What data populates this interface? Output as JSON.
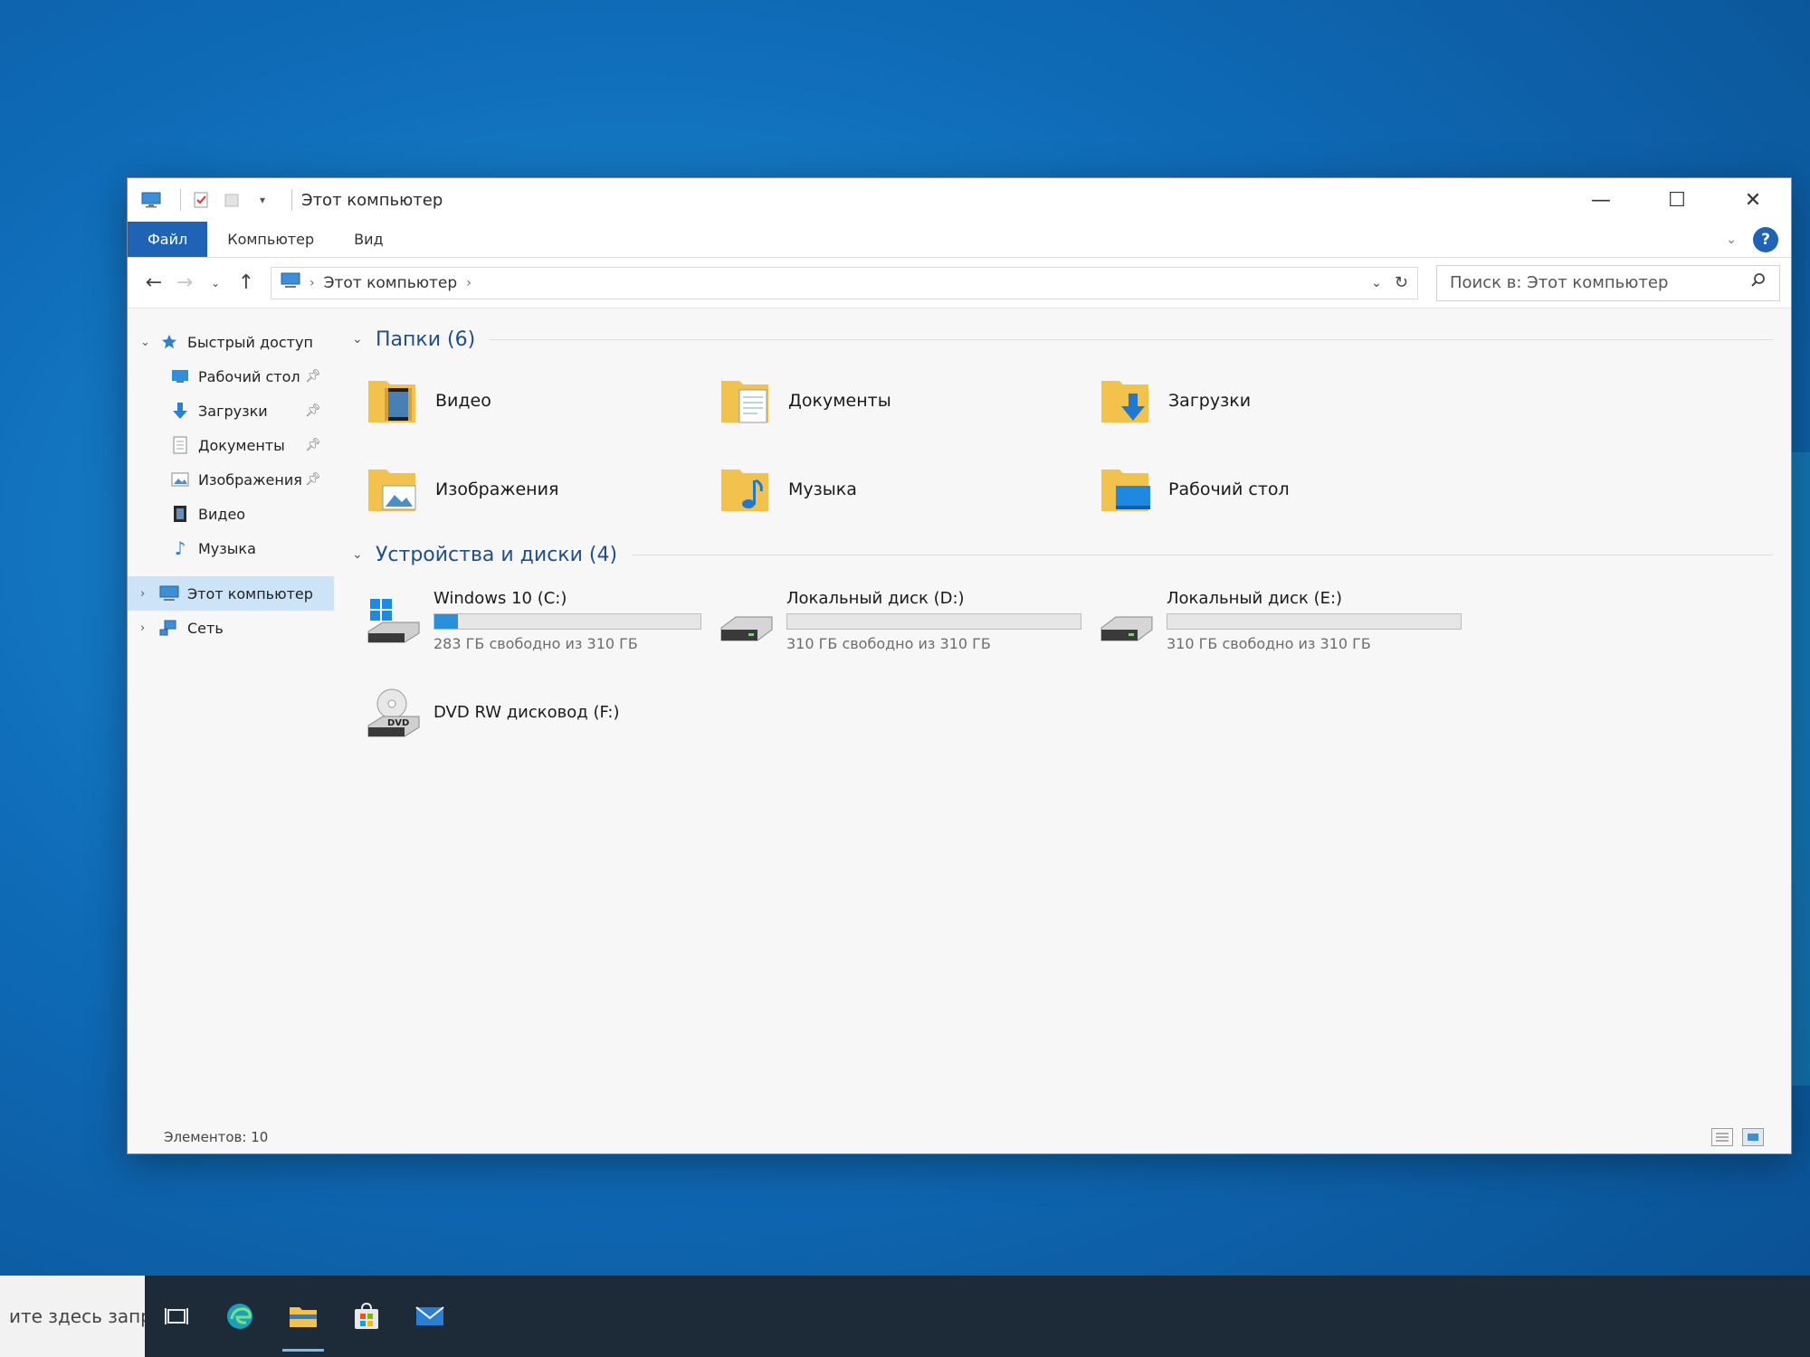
{
  "window": {
    "title": "Этот компьютер",
    "controls": {
      "minimize": "—",
      "maximize": "☐",
      "close": "✕"
    }
  },
  "ribbon": {
    "tabs": [
      {
        "label": "Файл",
        "active": true
      },
      {
        "label": "Компьютер"
      },
      {
        "label": "Вид"
      }
    ],
    "help": "?"
  },
  "addressbar": {
    "crumbs": [
      "Этот компьютер"
    ],
    "search_placeholder": "Поиск в: Этот компьютер"
  },
  "sidebar": {
    "quick_access": "Быстрый доступ",
    "items": [
      {
        "label": "Рабочий стол",
        "icon": "desktop-icon",
        "pinned": true
      },
      {
        "label": "Загрузки",
        "icon": "download-icon",
        "pinned": true
      },
      {
        "label": "Документы",
        "icon": "document-icon",
        "pinned": true
      },
      {
        "label": "Изображения",
        "icon": "pictures-icon",
        "pinned": true
      },
      {
        "label": "Видео",
        "icon": "video-icon",
        "pinned": false
      },
      {
        "label": "Музыка",
        "icon": "music-icon",
        "pinned": false
      }
    ],
    "this_pc": "Этот компьютер",
    "network": "Сеть"
  },
  "content": {
    "folders_header": "Папки (6)",
    "folders": [
      {
        "name": "Видео",
        "icon": "video-folder-icon"
      },
      {
        "name": "Документы",
        "icon": "documents-folder-icon"
      },
      {
        "name": "Загрузки",
        "icon": "downloads-folder-icon"
      },
      {
        "name": "Изображения",
        "icon": "pictures-folder-icon"
      },
      {
        "name": "Музыка",
        "icon": "music-folder-icon"
      },
      {
        "name": "Рабочий стол",
        "icon": "desktop-folder-icon"
      }
    ],
    "drives_header": "Устройства и диски (4)",
    "drives": [
      {
        "name": "Windows 10 (C:)",
        "free": "283 ГБ свободно из 310 ГБ",
        "used_fraction": 0.087,
        "icon": "windows-drive-icon"
      },
      {
        "name": "Локальный диск (D:)",
        "free": "310 ГБ свободно из 310 ГБ",
        "used_fraction": 0.0,
        "icon": "hard-drive-icon"
      },
      {
        "name": "Локальный диск (E:)",
        "free": "310 ГБ свободно из 310 ГБ",
        "used_fraction": 0.0,
        "icon": "hard-drive-icon"
      },
      {
        "name": "DVD RW дисковод (F:)",
        "icon": "dvd-drive-icon"
      }
    ]
  },
  "statusbar": {
    "items_count": "Элементов: 10"
  },
  "taskbar": {
    "search_text": "ите здесь запрос",
    "icons": [
      "task-view-icon",
      "edge-icon",
      "file-explorer-icon",
      "store-icon",
      "mail-icon"
    ]
  },
  "colors": {
    "accent": "#1e63b6",
    "drive_bar": "#2a8fdc",
    "folder": "#f3c24c"
  }
}
